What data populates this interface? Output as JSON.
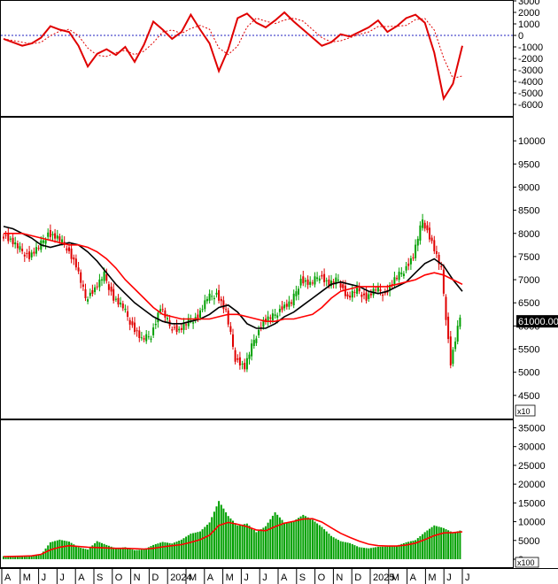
{
  "colors": {
    "background": "#ffffff",
    "frame": "#000000",
    "up": "#00a000",
    "down": "#e00000",
    "ma_slow": "#000000",
    "ma_fast": "#ff0000",
    "price_label_bg": "#000000",
    "price_label_text": "#ffffff",
    "zero_line": "#2020c0"
  },
  "chart_data": [
    {
      "type": "line",
      "panel": "oscillator",
      "ylim": [
        -7000,
        3000
      ],
      "y_ticks": [
        "3000",
        "2000",
        "1000",
        "0",
        "-1000",
        "-2000",
        "-3000",
        "-4000",
        "-5000",
        "-6000"
      ],
      "zero_line": 0,
      "series": [
        {
          "values": [
            -300,
            -600,
            -900,
            -700,
            -200,
            800,
            500,
            300,
            -900,
            -2700,
            -1600,
            -1200,
            -1700,
            -1000,
            -2300,
            -800,
            1200,
            500,
            -300,
            300,
            1800,
            500,
            -700,
            -3100,
            -1200,
            1500,
            1900,
            1100,
            700,
            1300,
            2000,
            1200,
            500,
            -200,
            -900,
            -600,
            100,
            -100,
            300,
            700,
            1300,
            300,
            800,
            1500,
            1800,
            1100,
            -1500,
            -5500,
            -4200,
            -900
          ]
        }
      ]
    },
    {
      "type": "line",
      "panel": "price",
      "ylim": [
        4000,
        10500
      ],
      "y_ticks": [
        "10000",
        "9500",
        "9000",
        "8500",
        "8000",
        "7500",
        "7000",
        "6500",
        "6000",
        "5500",
        "5000",
        "4500"
      ],
      "y_multiplier_label": "x10",
      "last_price_label": "61000.00",
      "series": [
        {
          "values": [
            8000,
            7850,
            7650,
            7500,
            7700,
            8000,
            7900,
            7700,
            7300,
            6600,
            6800,
            7100,
            6600,
            6400,
            6000,
            5700,
            5800,
            6400,
            6000,
            5900,
            6100,
            6200,
            6600,
            6700,
            6300,
            5300,
            5100,
            5700,
            6100,
            6200,
            6400,
            6500,
            7000,
            6900,
            7100,
            6900,
            7000,
            6600,
            6800,
            6600,
            6800,
            6700,
            7000,
            7200,
            7500,
            8300,
            7800,
            7200,
            5200,
            6200
          ]
        },
        {
          "values": [
            8150,
            8100,
            8000,
            7900,
            7750,
            7700,
            7750,
            7800,
            7750,
            7600,
            7400,
            7150,
            6900,
            6700,
            6500,
            6350,
            6200,
            6100,
            6050,
            6050,
            6100,
            6150,
            6250,
            6400,
            6450,
            6300,
            6050,
            5950,
            5950,
            6050,
            6200,
            6300,
            6450,
            6600,
            6750,
            6900,
            6950,
            6900,
            6850,
            6750,
            6700,
            6750,
            6850,
            6950,
            7150,
            7350,
            7450,
            7300,
            7000,
            6750
          ]
        },
        {
          "values": [
            8000,
            8000,
            8000,
            7950,
            7900,
            7850,
            7800,
            7750,
            7750,
            7700,
            7600,
            7450,
            7250,
            7000,
            6800,
            6600,
            6400,
            6250,
            6200,
            6150,
            6150,
            6150,
            6150,
            6200,
            6250,
            6250,
            6200,
            6150,
            6100,
            6100,
            6150,
            6150,
            6200,
            6250,
            6400,
            6600,
            6750,
            6800,
            6850,
            6850,
            6850,
            6850,
            6900,
            6950,
            7000,
            7100,
            7150,
            7100,
            7000,
            6900
          ]
        }
      ]
    },
    {
      "type": "bar",
      "panel": "volume",
      "ylim": [
        0,
        37000
      ],
      "y_ticks": [
        "35000",
        "30000",
        "25000",
        "20000",
        "15000",
        "10000",
        "5000",
        "0"
      ],
      "y_multiplier_label": "x100",
      "series": [
        {
          "values": [
            800,
            900,
            700,
            900,
            1200,
            4500,
            5200,
            4700,
            3200,
            2600,
            4800,
            3800,
            2900,
            3200,
            2400,
            2600,
            3800,
            4600,
            4200,
            5200,
            6800,
            7400,
            9800,
            15500,
            11500,
            9000,
            9500,
            7200,
            8800,
            12500,
            9800,
            10200,
            11800,
            10500,
            8600,
            6200,
            4800,
            4300,
            3200,
            2900,
            3300,
            3400,
            3600,
            4500,
            5100,
            7200,
            9000,
            8300,
            7100,
            7800
          ]
        },
        {
          "values": [
            700,
            750,
            800,
            900,
            1300,
            2500,
            3200,
            3600,
            3400,
            3200,
            3100,
            3000,
            2900,
            2900,
            2800,
            2700,
            2900,
            3300,
            3600,
            3900,
            4500,
            5200,
            6400,
            9000,
            9800,
            9300,
            8700,
            7800,
            7600,
            8700,
            9600,
            10100,
            10700,
            10800,
            9900,
            8400,
            6900,
            5800,
            4800,
            4000,
            3600,
            3500,
            3500,
            3800,
            4300,
            5200,
            6300,
            7000,
            7100,
            7300
          ]
        }
      ]
    }
  ],
  "x_axis_labels": [
    "A",
    "M",
    "J",
    "J",
    "A",
    "S",
    "O",
    "N",
    "D",
    "2024",
    "M",
    "A",
    "M",
    "J",
    "J",
    "A",
    "S",
    "O",
    "N",
    "D",
    "2025",
    "M",
    "A",
    "M",
    "J",
    "J"
  ]
}
